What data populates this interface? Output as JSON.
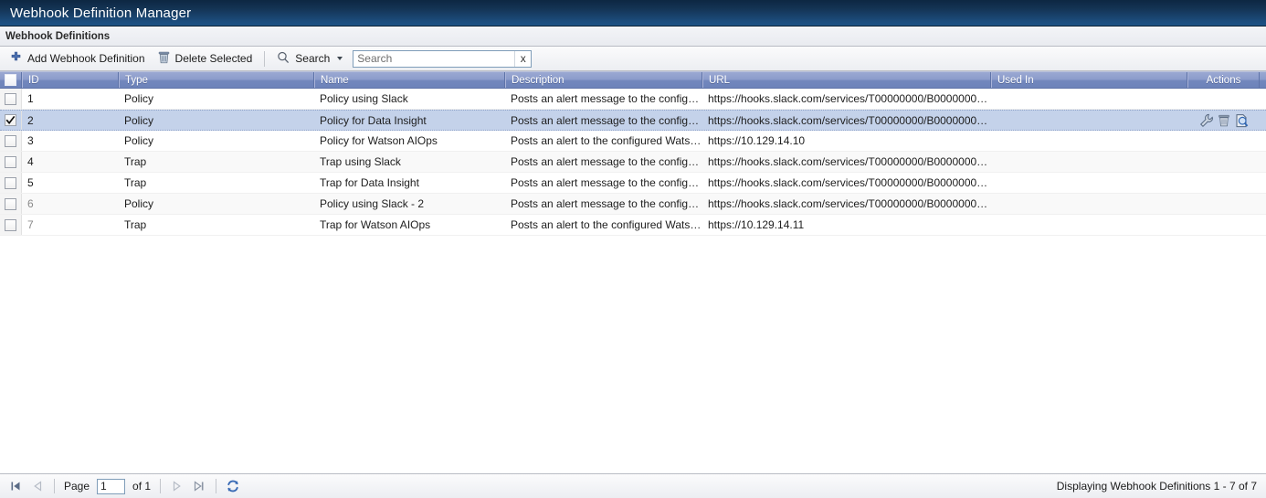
{
  "window": {
    "title": "Webhook Definition Manager"
  },
  "section": {
    "title": "Webhook Definitions"
  },
  "toolbar": {
    "add_label": "Add Webhook Definition",
    "delete_label": "Delete Selected",
    "search_label": "Search",
    "search_value": "",
    "search_placeholder": "Search",
    "clear_label": "x",
    "icons": {
      "add": "plus-icon",
      "delete": "trash-icon",
      "search": "magnifier-icon",
      "dropdown": "chevron-down-icon",
      "clear": "clear-icon"
    }
  },
  "grid": {
    "columns": [
      {
        "key": "check",
        "label": ""
      },
      {
        "key": "id",
        "label": "ID"
      },
      {
        "key": "type",
        "label": "Type"
      },
      {
        "key": "name",
        "label": "Name"
      },
      {
        "key": "description",
        "label": "Description"
      },
      {
        "key": "url",
        "label": "URL"
      },
      {
        "key": "used_in",
        "label": "Used In"
      },
      {
        "key": "actions",
        "label": "Actions"
      }
    ],
    "select_all_checked": false,
    "rows": [
      {
        "checked": false,
        "id": "1",
        "type": "Policy",
        "name": "Policy using Slack",
        "description": "Posts an alert message to the configure...",
        "url": "https://hooks.slack.com/services/T00000000/B00000000/XX...",
        "used_in": "",
        "id_dim": false,
        "show_actions": false
      },
      {
        "checked": true,
        "id": "2",
        "type": "Policy",
        "name": "Policy for Data Insight",
        "description": "Posts an alert message to the configure...",
        "url": "https://hooks.slack.com/services/T00000000/B00000000/XX...",
        "used_in": "",
        "id_dim": false,
        "show_actions": true
      },
      {
        "checked": false,
        "id": "3",
        "type": "Policy",
        "name": "Policy for Watson AIOps",
        "description": "Posts an alert to the configured Watson...",
        "url": "https://10.129.14.10",
        "used_in": "",
        "id_dim": false,
        "show_actions": false
      },
      {
        "checked": false,
        "id": "4",
        "type": "Trap",
        "name": "Trap using Slack",
        "description": "Posts an alert message to the configure...",
        "url": "https://hooks.slack.com/services/T00000000/B00000000/XX...",
        "used_in": "",
        "id_dim": false,
        "show_actions": false
      },
      {
        "checked": false,
        "id": "5",
        "type": "Trap",
        "name": "Trap for Data Insight",
        "description": "Posts an alert message to the configure...",
        "url": "https://hooks.slack.com/services/T00000000/B00000000/XX...",
        "used_in": "",
        "id_dim": false,
        "show_actions": false
      },
      {
        "checked": false,
        "id": "6",
        "type": "Policy",
        "name": "Policy using Slack - 2",
        "description": "Posts an alert message to the configure...",
        "url": "https://hooks.slack.com/services/T00000000/B00000000/XX...",
        "used_in": "",
        "id_dim": true,
        "show_actions": false
      },
      {
        "checked": false,
        "id": "7",
        "type": "Trap",
        "name": "Trap for Watson AIOps",
        "description": "Posts an alert to the configured Watson...",
        "url": "https://10.129.14.11",
        "used_in": "",
        "id_dim": true,
        "show_actions": false
      }
    ],
    "row_action_icons": [
      "wrench-icon",
      "trash-icon",
      "view-details-icon"
    ]
  },
  "footer": {
    "page_label": "Page",
    "page_value": "1",
    "of_label": "of 1",
    "status": "Displaying Webhook Definitions 1 - 7 of 7",
    "icons": {
      "first": "first-page-icon",
      "prev": "previous-page-icon",
      "next": "next-page-icon",
      "last": "last-page-icon",
      "refresh": "refresh-icon"
    }
  },
  "colors": {
    "title_bar": "#143455",
    "header_gradient_top": "#9aa8d2",
    "header_gradient_bottom": "#6d83ba",
    "selected_row": "#c4d2ea",
    "accent": "#4a6fb0"
  }
}
